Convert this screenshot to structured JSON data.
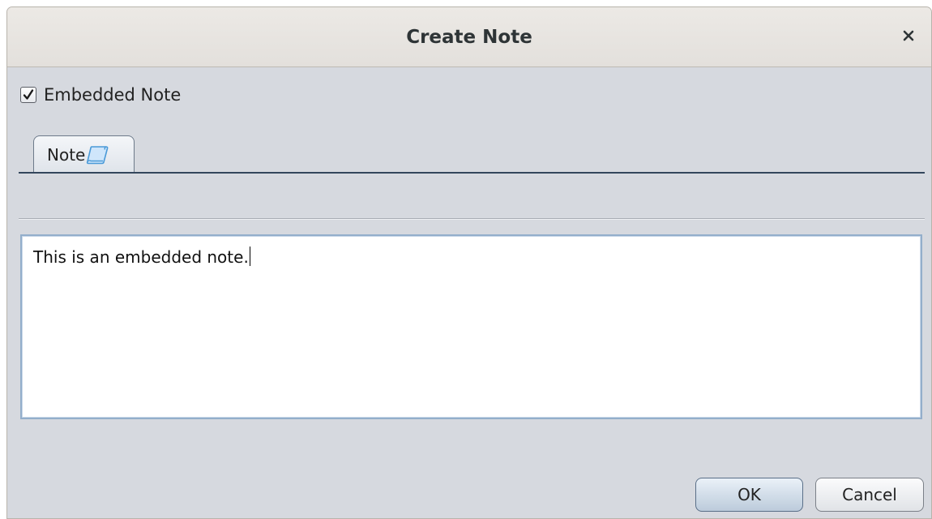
{
  "dialog": {
    "title": "Create Note",
    "close_icon": "close-icon"
  },
  "embedded_checkbox": {
    "label": "Embedded Note",
    "checked": true
  },
  "tabs": [
    {
      "label": "Note",
      "icon": "note-icon",
      "selected": true
    }
  ],
  "note": {
    "text": "This is an embedded note."
  },
  "buttons": {
    "ok_label": "OK",
    "cancel_label": "Cancel"
  },
  "colors": {
    "window_bg": "#d6d9df",
    "titlebar_bg": "#e8e5e1",
    "focus_border": "#93aecb",
    "tab_line": "#33465c"
  }
}
